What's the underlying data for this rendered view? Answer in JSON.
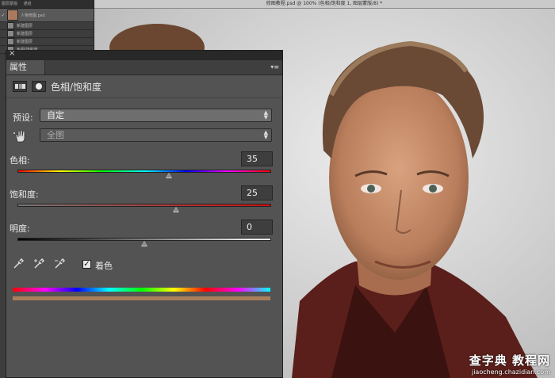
{
  "document": {
    "title": "修图教程.psd @ 100% (色相/饱和度 1, 图层蒙版/8) *"
  },
  "layers_panel": {
    "tabs": [
      "图层蒙版",
      "通道"
    ],
    "rows": [
      "人物修图.psd",
      "新建图层",
      "新建图层",
      "新建图层",
      "色相/饱和度"
    ]
  },
  "properties": {
    "tab_label": "属性",
    "adjustment_label": "色相/饱和度",
    "preset_label": "预设:",
    "preset_value": "自定",
    "channel_value": "全图",
    "hue": {
      "label": "色相:",
      "value": "35",
      "min": -180,
      "max": 180
    },
    "saturation": {
      "label": "饱和度:",
      "value": "25",
      "min": -100,
      "max": 100
    },
    "lightness": {
      "label": "明度:",
      "value": "0",
      "min": -100,
      "max": 100
    },
    "colorize_label": "着色",
    "colorize_checked": true,
    "colorize_swatch": "#a97e5c"
  },
  "watermark": {
    "line1": "查字典 教程网",
    "line2": "jiaocheng.chazidian.com"
  }
}
